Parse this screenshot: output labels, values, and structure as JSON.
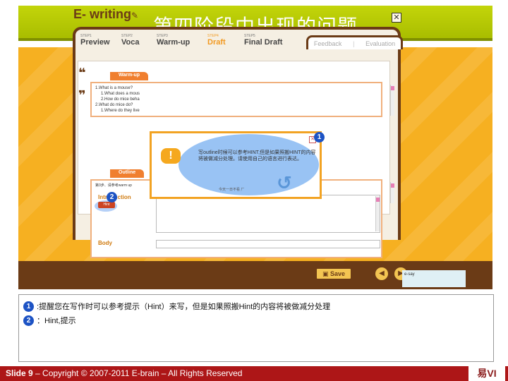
{
  "title": "第四阶段中出现的问题",
  "app": {
    "brand": "E- writing",
    "steps": [
      {
        "num": "STEP1",
        "name": "Preview"
      },
      {
        "num": "STEP2",
        "name": "Voca"
      },
      {
        "num": "STEP3",
        "name": "Warm-up"
      },
      {
        "num": "STEP4",
        "name": "Draft"
      },
      {
        "num": "STEP5",
        "name": "Final Draft"
      }
    ],
    "tabs": [
      "Feedback",
      "Evaluation"
    ],
    "warmup": {
      "label": "Warm-up",
      "lines": [
        "1.What is a mouse?",
        "1.What does a mous",
        "2.How do mice beha",
        "2.What do mice do?",
        "1.Where do they live"
      ]
    },
    "outline": {
      "label": "Outline",
      "hint_line": "第3步、请参考warm up",
      "intro_label": "Introduction",
      "hint_button": "Hint",
      "body_label": "Body"
    },
    "save_label": "Save",
    "brand_small": "e-say",
    "popup": {
      "text": "写outline时候可以参考HINT,但是如果照搬HINT的内容将被做减分处理。请使用自己的语言进行表达。",
      "footer": "今天一日不看 厂"
    }
  },
  "markers": [
    "1",
    "2"
  ],
  "notes": [
    {
      "marker": "1",
      "text": ":提醒您在写作时可以参考提示（Hint）来写，但是如果照搬Hint的内容将被做减分处理"
    },
    {
      "marker": "2",
      "text": "：Hint,提示"
    }
  ],
  "footer": {
    "slide": "Slide 9",
    "copyright": " – Copyright © 2007-2011 E-brain – All Rights Reserved"
  },
  "logo_text": "易VI"
}
